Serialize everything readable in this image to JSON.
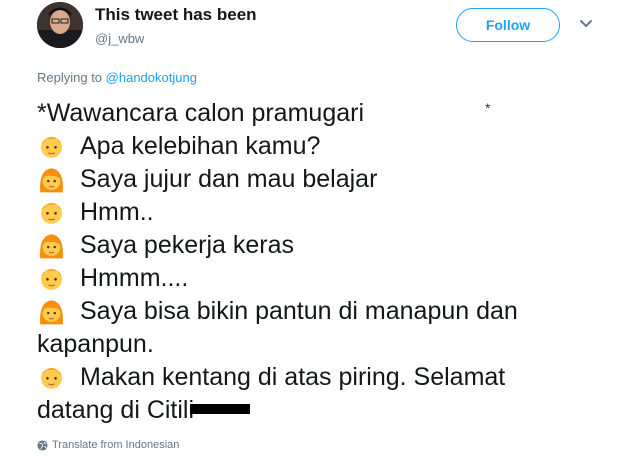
{
  "header": {
    "display_name": "This tweet has been",
    "handle": "@j_wbw",
    "follow_label": "Follow"
  },
  "reply": {
    "prefix": "Replying to",
    "mention": "@handokotjung"
  },
  "tweet": {
    "line1": "*Wawancara calon pramugari",
    "line2": "Apa kelebihan kamu?",
    "line3": "Saya jujur dan mau belajar",
    "line4": "Hmm..",
    "line5": "Saya pekerja keras",
    "line6": "Hmmm....",
    "line7": "Saya bisa bikin pantun di manapun dan",
    "line8": "kapanpun.",
    "line9": "Makan kentang di atas piring. Selamat",
    "line10": "datang di Citili",
    "stray_mark": "*"
  },
  "footer": {
    "translate_label": "Translate from Indonesian"
  },
  "colors": {
    "accent": "#1da1f2",
    "muted": "#657786"
  }
}
